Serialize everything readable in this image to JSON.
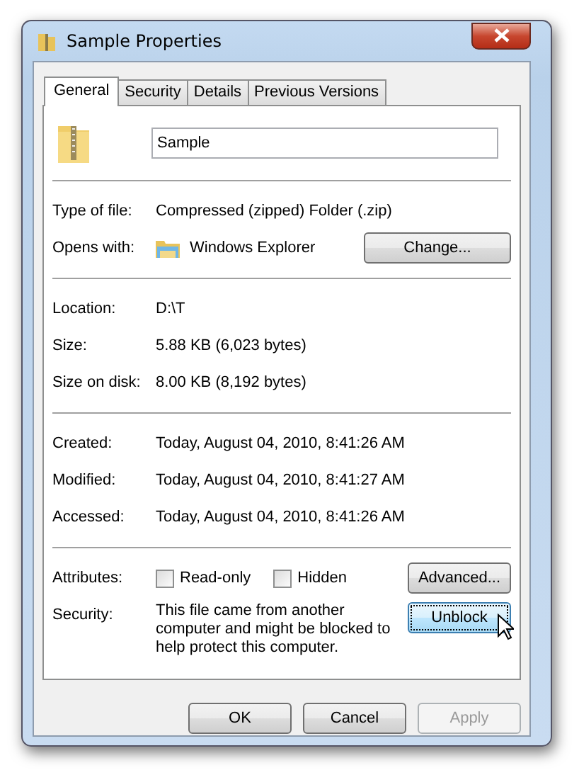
{
  "window": {
    "title": "Sample Properties"
  },
  "tabs": [
    {
      "label": "General",
      "selected": true
    },
    {
      "label": "Security",
      "selected": false
    },
    {
      "label": "Details",
      "selected": false
    },
    {
      "label": "Previous Versions",
      "selected": false
    }
  ],
  "name_field": {
    "value": "Sample"
  },
  "sections": [
    [
      {
        "kind": "text",
        "label": "Type of file:",
        "value": "Compressed (zipped) Folder (.zip)"
      },
      {
        "kind": "app",
        "label": "Opens with:",
        "value": "Windows Explorer",
        "button": {
          "label": "Change...",
          "disabled": false,
          "focused": false
        }
      }
    ],
    [
      {
        "kind": "text",
        "label": "Location:",
        "value": "D:\\T"
      },
      {
        "kind": "text",
        "label": "Size:",
        "value": "5.88 KB (6,023 bytes)"
      },
      {
        "kind": "text",
        "label": "Size on disk:",
        "value": "8.00 KB (8,192 bytes)"
      }
    ],
    [
      {
        "kind": "text",
        "label": "Created:",
        "value": "Today, August 04, 2010, 8:41:26 AM"
      },
      {
        "kind": "text",
        "label": "Modified:",
        "value": "Today, August 04, 2010, 8:41:27 AM"
      },
      {
        "kind": "text",
        "label": "Accessed:",
        "value": "Today, August 04, 2010, 8:41:26 AM"
      }
    ],
    [
      {
        "kind": "checkboxes",
        "label": "Attributes:",
        "checkboxes": [
          {
            "label": "Read-only",
            "checked": false
          },
          {
            "label": "Hidden",
            "checked": false
          }
        ],
        "button": {
          "label": "Advanced...",
          "disabled": false,
          "focused": false
        }
      },
      {
        "kind": "note",
        "label": "Security:",
        "value": "This file came from another computer and might be blocked to help protect this computer.",
        "button": {
          "label": "Unblock",
          "disabled": false,
          "focused": true
        }
      }
    ]
  ],
  "footer_buttons": [
    {
      "label": "OK",
      "disabled": false,
      "focused": false
    },
    {
      "label": "Cancel",
      "disabled": false,
      "focused": false
    },
    {
      "label": "Apply",
      "disabled": true,
      "focused": false
    }
  ]
}
